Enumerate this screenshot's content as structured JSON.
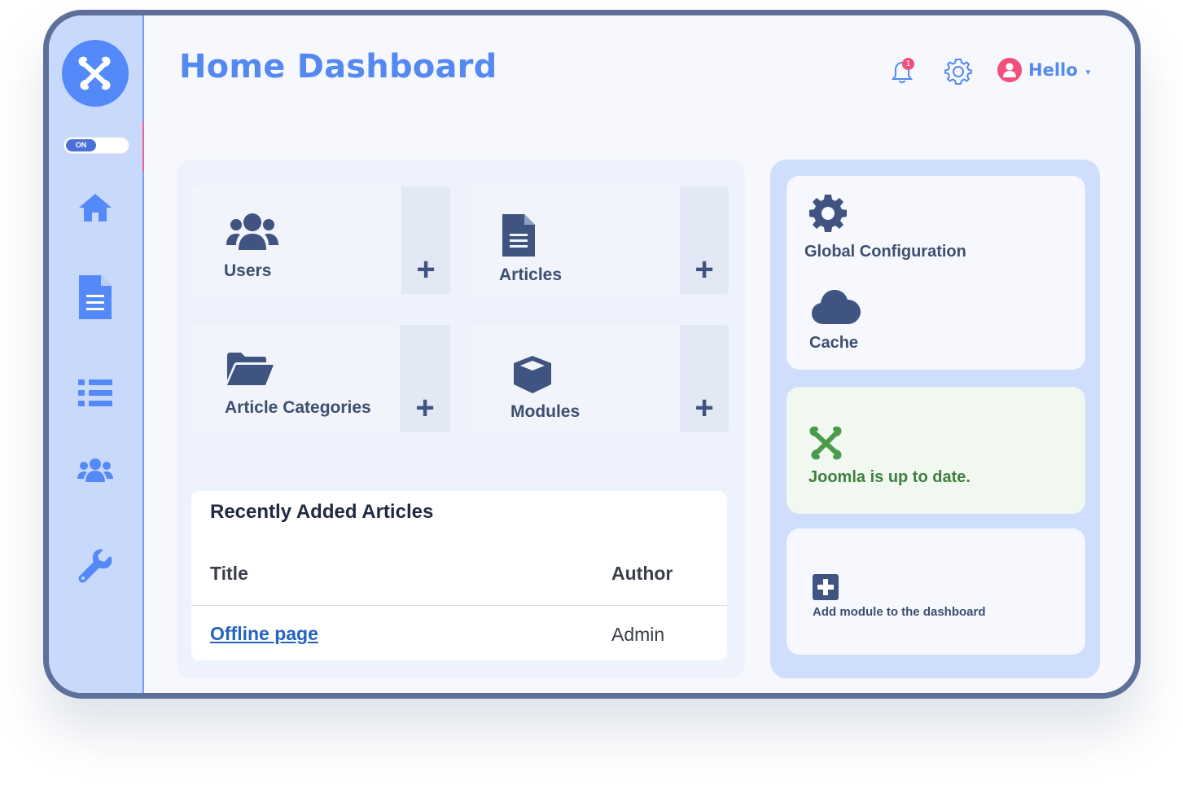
{
  "header": {
    "title": "Home Dashboard",
    "notifications_count": "1",
    "user_label": "Hello",
    "caret": "▾"
  },
  "sidebar": {
    "toggle_label": "ON",
    "items": [
      {
        "icon": "home-icon"
      },
      {
        "icon": "document-icon"
      },
      {
        "icon": "list-icon"
      },
      {
        "icon": "users-icon"
      },
      {
        "icon": "wrench-icon"
      }
    ]
  },
  "tiles": [
    {
      "label": "Users",
      "icon": "users-icon",
      "action": "+"
    },
    {
      "label": "Articles",
      "icon": "document-icon",
      "action": "+"
    },
    {
      "label": "Article Categories",
      "icon": "folder-open-icon",
      "action": "+"
    },
    {
      "label": "Modules",
      "icon": "cube-icon",
      "action": "+"
    }
  ],
  "recent_articles": {
    "heading": "Recently Added Articles",
    "columns": [
      "Title",
      "Author"
    ],
    "rows": [
      {
        "title": "Offline page",
        "author": "Admin"
      }
    ]
  },
  "right": {
    "global_config": "Global Configuration",
    "cache": "Cache",
    "update_status": "Joomla is up to date.",
    "add_module": "Add module to the dashboard"
  },
  "colors": {
    "accent": "#5389f0",
    "sidebar_bg": "#c9d9fb",
    "badge": "#f0507a",
    "success": "#3e7f40",
    "icon_dark": "#3f5480"
  }
}
